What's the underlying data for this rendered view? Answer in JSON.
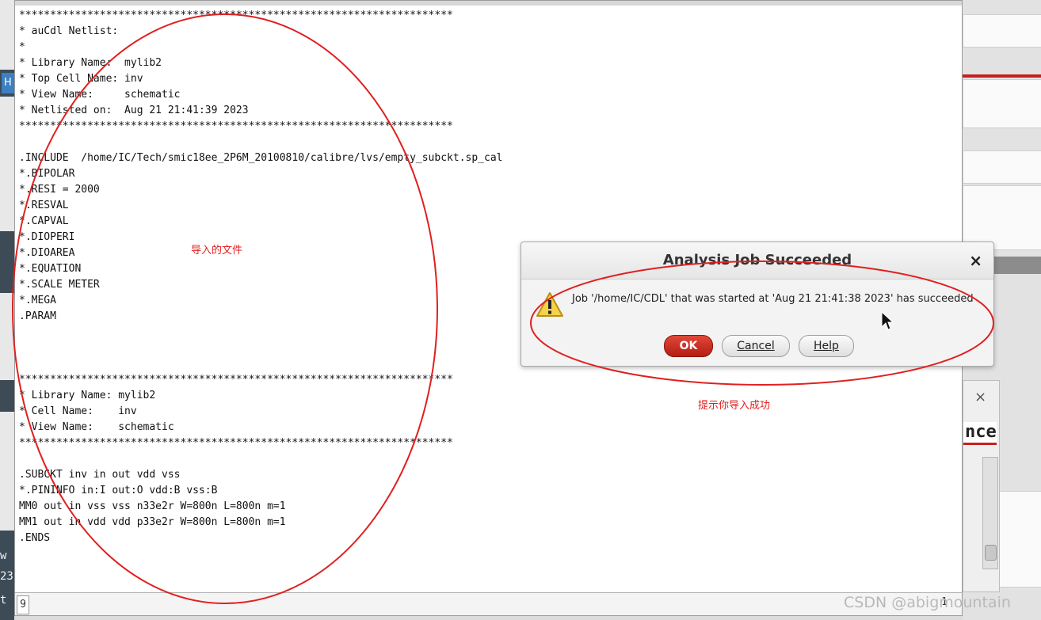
{
  "netlist": {
    "lines": [
      "**********************************************************************",
      "* auCdl Netlist:",
      "*",
      "* Library Name:  mylib2",
      "* Top Cell Name: inv",
      "* View Name:     schematic",
      "* Netlisted on:  Aug 21 21:41:39 2023",
      "**********************************************************************",
      "",
      ".INCLUDE  /home/IC/Tech/smic18ee_2P6M_20100810/calibre/lvs/empty_subckt.sp_cal",
      "*.BIPOLAR",
      "*.RESI = 2000",
      "*.RESVAL",
      "*.CAPVAL",
      "*.DIOPERI",
      "*.DIOAREA",
      "*.EQUATION",
      "*.SCALE METER",
      "*.MEGA",
      ".PARAM",
      "",
      "",
      "",
      "**********************************************************************",
      "* Library Name: mylib2",
      "* Cell Name:    inv",
      "* View Name:    schematic",
      "**********************************************************************",
      "",
      ".SUBCKT inv in out vdd vss",
      "*.PININFO in:I out:O vdd:B vss:B",
      "MM0 out in vss vss n33e2r W=800n L=800n m=1",
      "MM1 out in vdd vdd p33e2r W=800n L=800n m=1",
      ".ENDS"
    ]
  },
  "statusbar": {
    "line_number": "9",
    "column": "1"
  },
  "dialog": {
    "title": "Analysis Job Succeeded",
    "message": "Job '/home/IC/CDL' that was started at 'Aug 21 21:41:38 2023' has succeeded",
    "ok_label": "OK",
    "cancel_label": "Cancel",
    "help_label": "Help",
    "close_glyph": "×",
    "icon": "warning-icon"
  },
  "background": {
    "left_fragments": [
      "H",
      "w",
      "23",
      "t"
    ],
    "right_window_close": "×",
    "right_window_title_fragment": "nce"
  },
  "annotations": {
    "file_label": "导入的文件",
    "success_label": "提示你导入成功",
    "color": "#e02020"
  },
  "watermark": "CSDN @abigmountain",
  "colors": {
    "ok_button": "#c62d20",
    "annotation_red": "#e02020",
    "accent_red_rule": "#c62020"
  }
}
